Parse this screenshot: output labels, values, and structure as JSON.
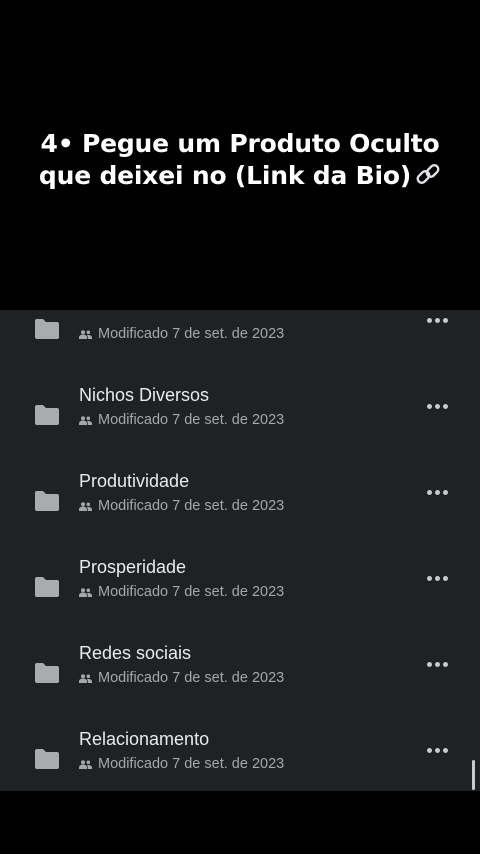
{
  "caption": {
    "line1": "4• Pegue um Produto Oculto",
    "line2": "que deixei no (Link da Bio)"
  },
  "icons": {
    "link": "link-icon",
    "folder": "folder-icon",
    "shared": "shared-people-icon",
    "more": "more-horizontal-icon"
  },
  "colors": {
    "panel_bg": "#202124",
    "folder": "#a9abae",
    "text": "#e8eaed",
    "meta": "#a5a7ab"
  },
  "files": [
    {
      "name": "",
      "modified": "Modificado 7 de set. de 2023"
    },
    {
      "name": "Nichos Diversos",
      "modified": "Modificado 7 de set. de 2023"
    },
    {
      "name": "Produtividade",
      "modified": "Modificado 7 de set. de 2023"
    },
    {
      "name": "Prosperidade",
      "modified": "Modificado 7 de set. de 2023"
    },
    {
      "name": "Redes sociais",
      "modified": "Modificado 7 de set. de 2023"
    },
    {
      "name": "Relacionamento",
      "modified": "Modificado 7 de set. de 2023"
    }
  ]
}
